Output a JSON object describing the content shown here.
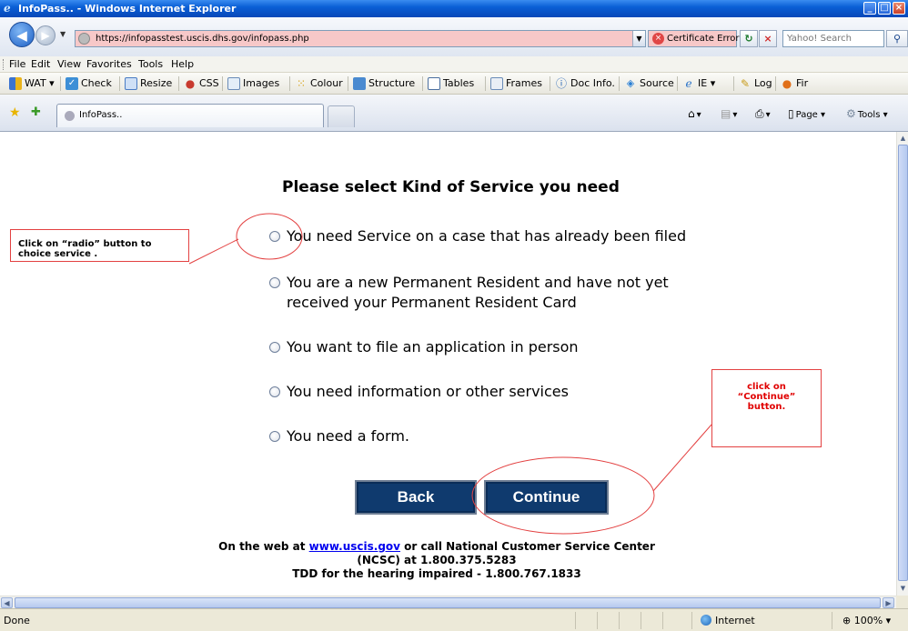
{
  "window": {
    "title": "InfoPass.. - Windows Internet Explorer"
  },
  "address": {
    "url": "https://infopasstest.uscis.dhs.gov/infopass.php",
    "cert_error": "Certificate Error",
    "search_placeholder": "Yahoo! Search"
  },
  "menu": [
    "File",
    "Edit",
    "View",
    "Favorites",
    "Tools",
    "Help"
  ],
  "toolbar": {
    "wat": "WAT",
    "check": "Check",
    "resize": "Resize",
    "css": "CSS",
    "images": "Images",
    "colour": "Colour",
    "structure": "Structure",
    "tables": "Tables",
    "frames": "Frames",
    "docinfo": "Doc Info.",
    "source": "Source",
    "ie": "IE",
    "log": "Log",
    "fir": "Fir"
  },
  "tabs": {
    "active": "InfoPass..",
    "page": "Page",
    "tools": "Tools"
  },
  "page": {
    "heading": "Please select Kind of Service you need",
    "options": [
      {
        "line1": "You need Service on a case that has already been filed"
      },
      {
        "line1": "You are a new Permanent Resident and have not yet",
        "line2": "received your Permanent Resident Card"
      },
      {
        "line1": "You want to file an application in person"
      },
      {
        "line1": "You need information or other services"
      },
      {
        "line1": "You need a form."
      }
    ],
    "back_label": "Back",
    "continue_label": "Continue",
    "footer": {
      "prefix": "On the web at ",
      "link": "www.uscis.gov",
      "suffix": " or call National Customer Service Center",
      "line2": "(NCSC) at 1.800.375.5283",
      "line3": "TDD for the hearing impaired - 1.800.767.1833"
    }
  },
  "callouts": {
    "left_line1": "Click on “radio” button to",
    "left_line2": "choice service .",
    "right_line1": "click on",
    "right_line2": "“Continue”",
    "right_line3": "button."
  },
  "status": {
    "text": "Done",
    "zone": "Internet",
    "zoom": "100%"
  },
  "colors": {
    "button_bg": "#0f3a6e",
    "annotation": "#e34141",
    "cert_error_bg": "#f7c8c8",
    "link": "#0000ee"
  }
}
